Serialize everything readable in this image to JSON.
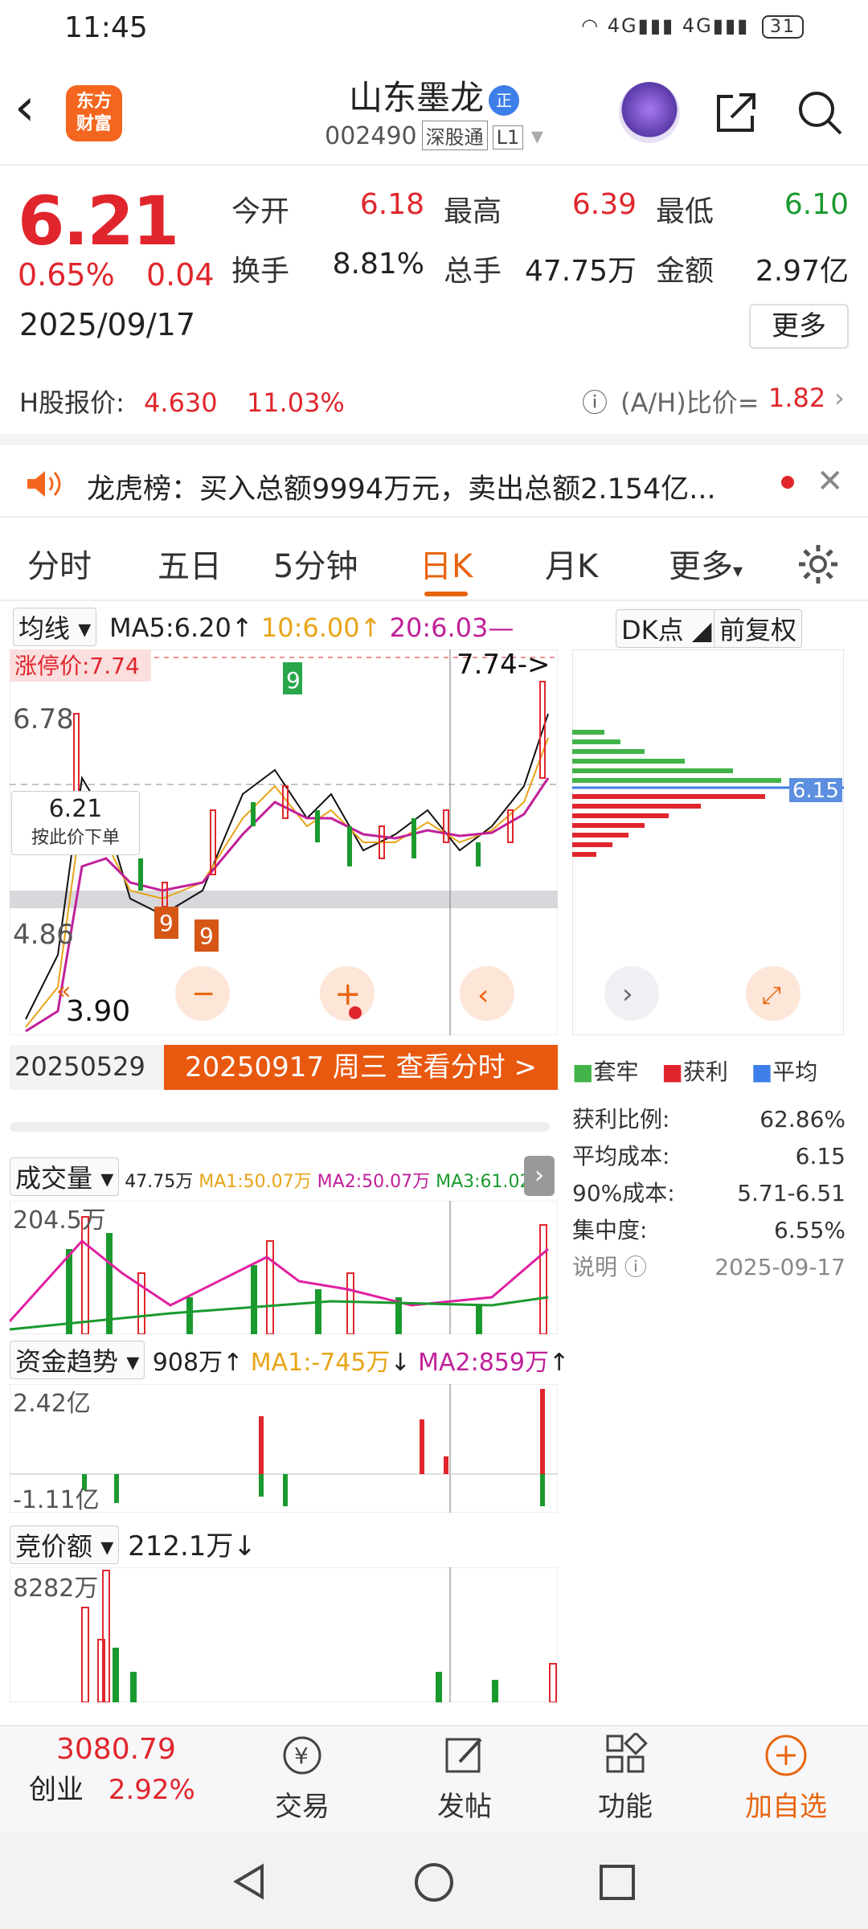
{
  "status_bar": {
    "time": "11:45",
    "network": "4G",
    "battery": "31"
  },
  "header": {
    "back_icon": "chevron-left-icon",
    "logo_text_1": "东方",
    "logo_text_2": "财富",
    "title": "山东墨龙",
    "badge": "正",
    "code": "002490",
    "tag1": "深股通",
    "tag2": "L1"
  },
  "quote": {
    "price": "6.21",
    "change_pct": "0.65%",
    "change_val": "0.04",
    "date": "2025/09/17",
    "open_label": "今开",
    "open": "6.18",
    "high_label": "最高",
    "high": "6.39",
    "low_label": "最低",
    "low": "6.10",
    "turnover_label": "换手",
    "turnover": "8.81%",
    "volume_label": "总手",
    "volume": "47.75万",
    "amount_label": "金额",
    "amount": "2.97亿",
    "more": "更多",
    "h_label": "H股报价:",
    "h_price": "4.630",
    "h_pct": "11.03%",
    "ah_label": "(A/H)比价=",
    "ah_value": "1.82"
  },
  "notice": {
    "text": "龙虎榜：买入总额9994万元，卖出总额2.154亿..."
  },
  "tabs": [
    "分时",
    "五日",
    "5分钟",
    "日K",
    "月K",
    "更多"
  ],
  "active_tab": "日K",
  "chart": {
    "ma_selector": "均线",
    "ma5": "MA5:6.20",
    "ma10": "10:6.00",
    "ma20": "20:6.03",
    "dk_button": "DK点",
    "fq_button": "前复权",
    "limit_label": "涨停价:7.74",
    "top_right": "7.74->",
    "y1": "6.78",
    "y2": "4.86",
    "low_mark": "3.90",
    "price_box": "6.21",
    "price_box_sub": "按此价下单",
    "date_left": "20250529",
    "date_btn": "20250917 周三 查看分时 >",
    "cost_label": "6.15",
    "vol_selector": "成交量",
    "vol_info": "47.75万",
    "vol_ma1": "MA1:50.07万",
    "vol_ma2": "MA2:50.07万",
    "vol_ma3": "MA3:61.02万",
    "vol_top": "204.5万",
    "fund_selector": "资金趋势",
    "fund_val": "908万",
    "fund_ma1": "MA1:-745万",
    "fund_ma2": "MA2:859万",
    "fund_top": "2.42亿",
    "fund_bottom": "-1.11亿",
    "bid_selector": "竞价额",
    "bid_val": "212.1万",
    "bid_top": "8282万"
  },
  "chip": {
    "legend_1": "套牢",
    "legend_2": "获利",
    "legend_3": "平均",
    "profit_label": "获利比例:",
    "profit": "62.86%",
    "avg_label": "平均成本:",
    "avg": "6.15",
    "c90_label": "90%成本:",
    "c90": "5.71-6.51",
    "conc_label": "集中度:",
    "conc": "6.55%",
    "note_label": "说明",
    "note_date": "2025-09-17"
  },
  "bottom_nav": {
    "index_value": "3080.79",
    "index_name": "创业",
    "index_pct": "2.92%",
    "trade": "交易",
    "post": "发帖",
    "func": "功能",
    "add": "加自选"
  },
  "colors": {
    "up": "#e0262c",
    "down": "#1a9a2e",
    "accent": "#e8650f"
  }
}
